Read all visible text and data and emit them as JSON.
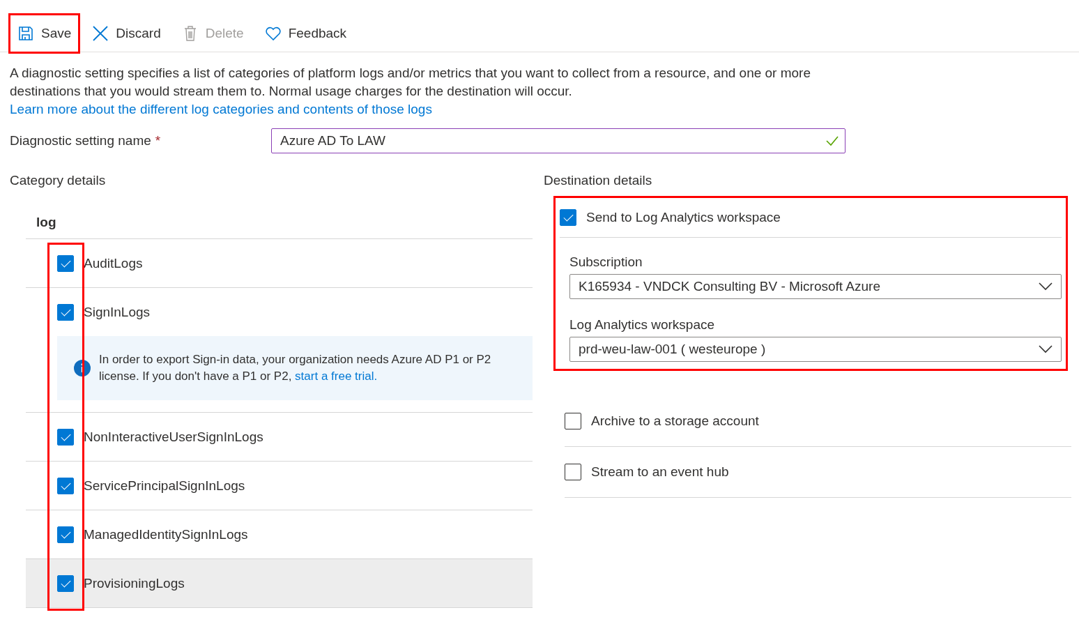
{
  "toolbar": [
    {
      "label": "Save",
      "kind": "save",
      "disabled": false,
      "highlighted": true
    },
    {
      "label": "Discard",
      "kind": "discard",
      "disabled": false,
      "highlighted": false
    },
    {
      "label": "Delete",
      "kind": "delete",
      "disabled": true,
      "highlighted": false
    },
    {
      "label": "Feedback",
      "kind": "feedback",
      "disabled": false,
      "highlighted": false
    }
  ],
  "description": {
    "text": "A diagnostic setting specifies a list of categories of platform logs and/or metrics that you want to collect from a resource, and one or more destinations that you would stream them to. Normal usage charges for the destination will occur.",
    "link": "Learn more about the different log categories and contents of those logs"
  },
  "name_field": {
    "label": "Diagnostic setting name",
    "required_mark": "*",
    "value": "Azure AD To LAW",
    "valid": true
  },
  "category_details": {
    "title": "Category details",
    "header": "log",
    "highlighted": true,
    "rows": [
      {
        "label": "AuditLogs",
        "checked": true,
        "selected": false
      },
      {
        "label": "SignInLogs",
        "checked": true,
        "selected": false,
        "notice": {
          "text": "In order to export Sign-in data, your organization needs Azure AD P1 or P2 license. If you don't have a P1 or P2,",
          "link": "start a free trial."
        }
      },
      {
        "label": "NonInteractiveUserSignInLogs",
        "checked": true,
        "selected": false
      },
      {
        "label": "ServicePrincipalSignInLogs",
        "checked": true,
        "selected": false
      },
      {
        "label": "ManagedIdentitySignInLogs",
        "checked": true,
        "selected": false
      },
      {
        "label": "ProvisioningLogs",
        "checked": true,
        "selected": true
      }
    ]
  },
  "destination_details": {
    "title": "Destination details",
    "destinations": [
      {
        "label": "Send to Log Analytics workspace",
        "checked": true,
        "highlighted": true,
        "fields": [
          {
            "label": "Subscription",
            "value": "K165934 - VNDCK Consulting BV - Microsoft Azure"
          },
          {
            "label": "Log Analytics workspace",
            "value": "prd-weu-law-001 ( westeurope )"
          }
        ]
      },
      {
        "label": "Archive to a storage account",
        "checked": false,
        "highlighted": false
      },
      {
        "label": "Stream to an event hub",
        "checked": false,
        "highlighted": false
      }
    ]
  }
}
